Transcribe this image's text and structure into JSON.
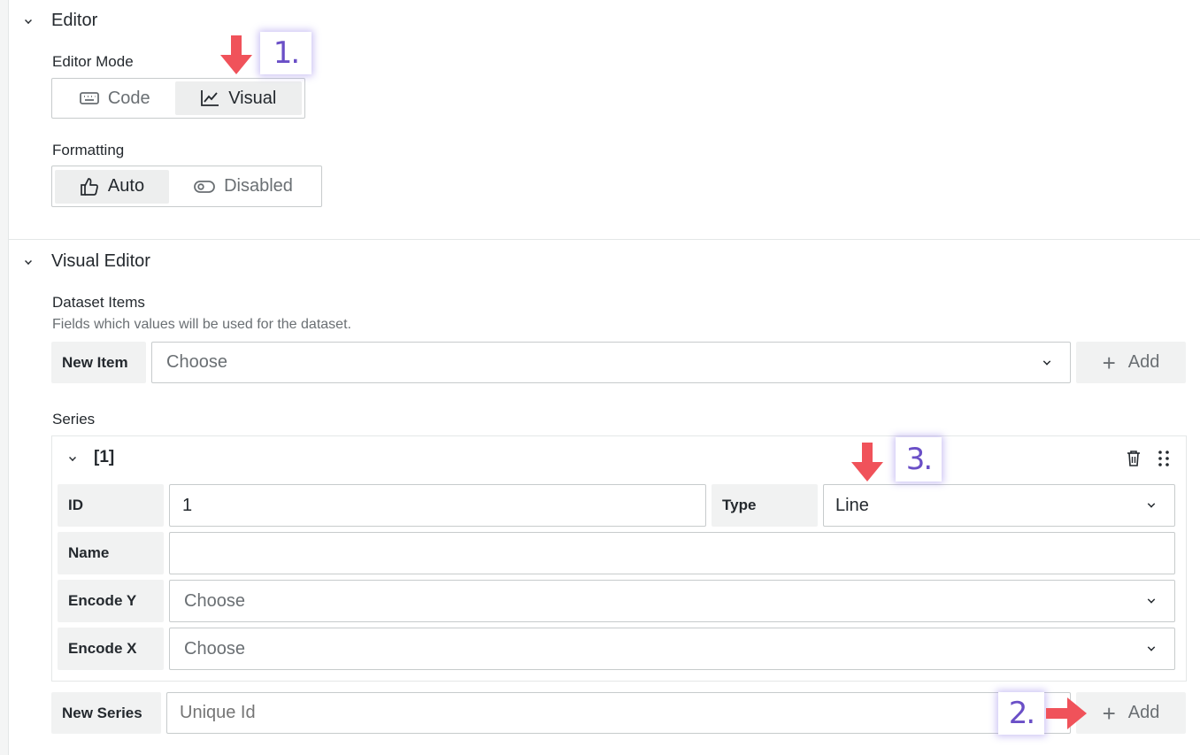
{
  "editor_section": {
    "title": "Editor",
    "editor_mode": {
      "label": "Editor Mode",
      "options": [
        {
          "label": "Code",
          "icon": "keyboard-icon",
          "active": false
        },
        {
          "label": "Visual",
          "icon": "line-chart-icon",
          "active": true
        }
      ]
    },
    "formatting": {
      "label": "Formatting",
      "options": [
        {
          "label": "Auto",
          "icon": "thumbs-up-icon",
          "active": true
        },
        {
          "label": "Disabled",
          "icon": "toggle-icon",
          "active": false
        }
      ]
    }
  },
  "visual_editor": {
    "title": "Visual Editor",
    "dataset_items": {
      "label": "Dataset Items",
      "description": "Fields which values will be used for the dataset.",
      "new_item_label": "New Item",
      "select_placeholder": "Choose",
      "add_label": "Add"
    },
    "series": {
      "label": "Series",
      "item": {
        "title": "[1]",
        "id_label": "ID",
        "id_value": "1",
        "type_label": "Type",
        "type_value": "Line",
        "name_label": "Name",
        "name_value": "",
        "encode_y_label": "Encode Y",
        "encode_y_value": "Choose",
        "encode_x_label": "Encode X",
        "encode_x_value": "Choose"
      },
      "new_series_label": "New Series",
      "new_series_placeholder": "Unique Id",
      "add_label": "Add"
    }
  },
  "annotations": {
    "step1": "1.",
    "step2": "2.",
    "step3": "3.",
    "arrow_color": "#f0525a",
    "callout_text_color": "#6a4fc7"
  }
}
